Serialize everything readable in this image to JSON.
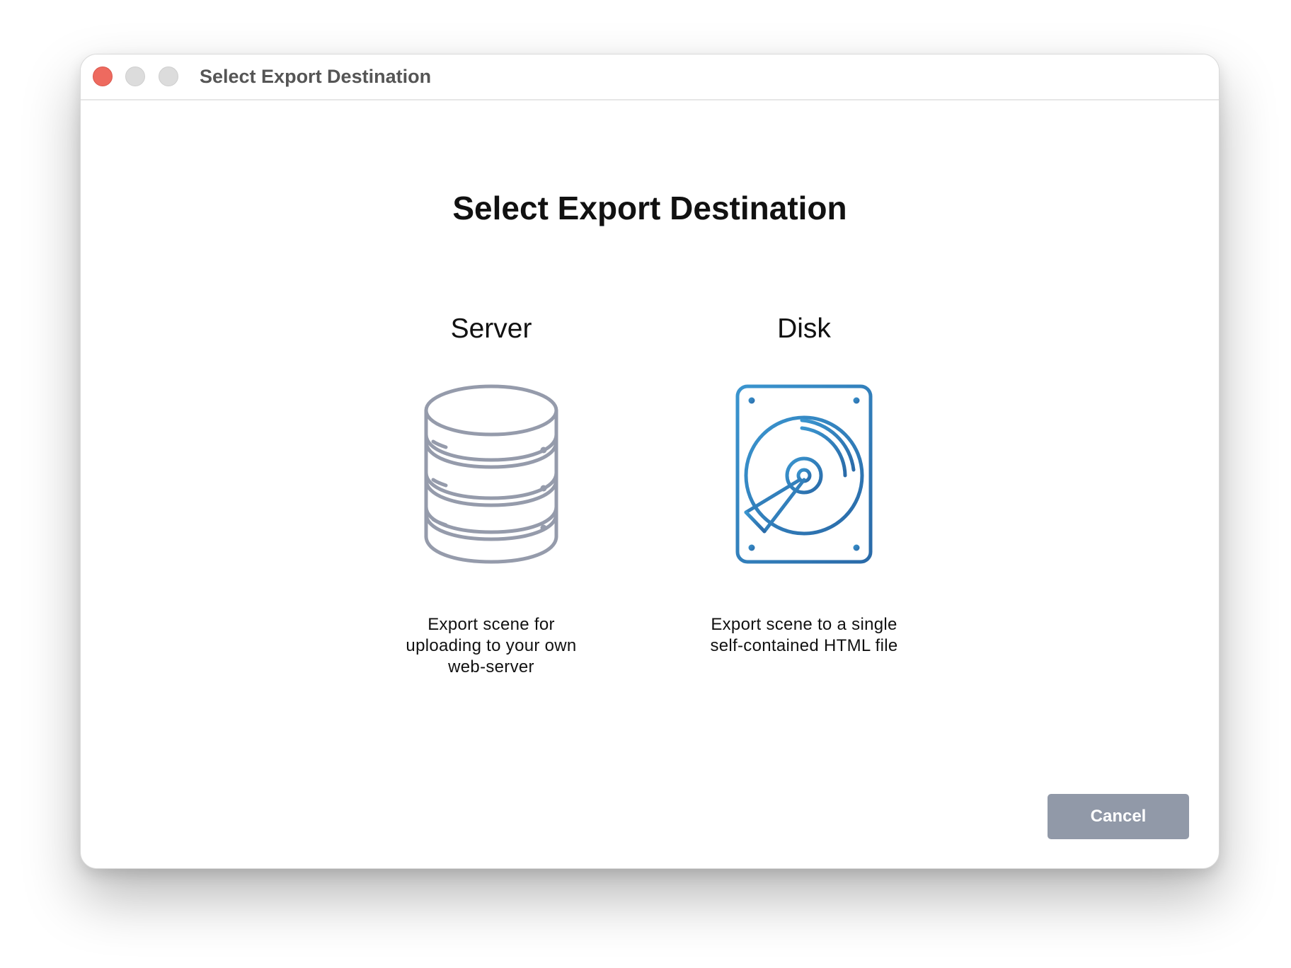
{
  "window": {
    "title": "Select Export Destination"
  },
  "dialog": {
    "heading": "Select Export Destination",
    "options": [
      {
        "label": "Server",
        "icon": "database-icon",
        "description": "Export scene for\nuploading to your own\nweb-server"
      },
      {
        "label": "Disk",
        "icon": "hard-drive-icon",
        "description": "Export scene to a single\nself-contained HTML file"
      }
    ],
    "cancel_label": "Cancel"
  },
  "colors": {
    "close": "#ee6a5f",
    "inactive_control": "#dcdcdc",
    "server_icon": "#959bab",
    "disk_icon_start": "#3a95cf",
    "disk_icon_end": "#2a6aa8",
    "cancel_button": "#9199a8"
  }
}
